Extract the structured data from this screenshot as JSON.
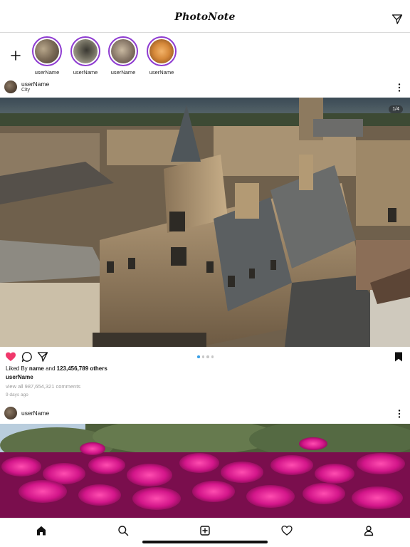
{
  "app": {
    "title": "PhotoNote"
  },
  "stories": [
    {
      "name": "userName",
      "colors": [
        "#7a6a56",
        "#b8a78b",
        "#4a3e33"
      ]
    },
    {
      "name": "userName",
      "colors": [
        "#6d6a5c",
        "#c8c2b0",
        "#3a3832"
      ]
    },
    {
      "name": "userName",
      "colors": [
        "#8a7a6a",
        "#c9b9a1",
        "#514438"
      ]
    },
    {
      "name": "userName",
      "colors": [
        "#d6893a",
        "#f2b36a",
        "#7a4519"
      ]
    }
  ],
  "post1": {
    "user": "userName",
    "location": "City",
    "image_counter": "1/4",
    "carousel": {
      "total": 4,
      "active": 1
    },
    "liked_by_prefix": "Liked By",
    "liked_by_name": "name",
    "liked_by_and": "and",
    "liked_by_count": "123,456,789 others",
    "caption_user": "userName",
    "comments_link": "view all 987,654,321 comments",
    "time": "9 days ago",
    "liked": true,
    "saved": true
  },
  "post2": {
    "user": "userName"
  },
  "colors": {
    "story_ring": "#8e3bd1",
    "like": "#f0386b",
    "carousel_active": "#3aa0e6"
  },
  "icons": {
    "header": "send-icon",
    "stories_add": "plus-icon",
    "post_menu": "kebab-icon",
    "actions": [
      "heart-icon",
      "comment-icon",
      "share-icon",
      "bookmark-icon"
    ],
    "tabs": [
      "home-icon",
      "search-icon",
      "add-post-icon",
      "heart-outline-icon",
      "profile-icon"
    ]
  }
}
